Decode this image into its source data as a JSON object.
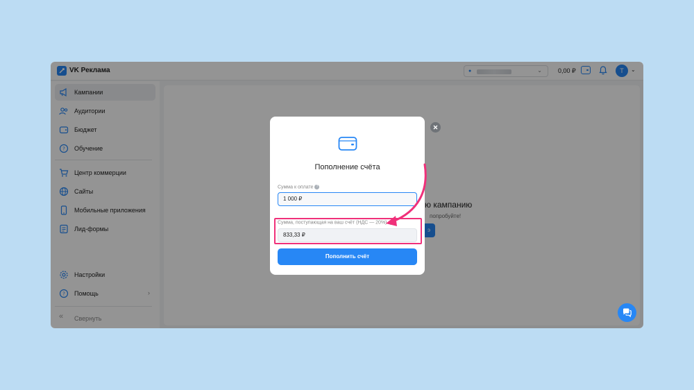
{
  "header": {
    "logo_text": "VK Реклама",
    "balance": "0,00 ₽",
    "avatar_letter": "T"
  },
  "sidebar": {
    "items": [
      {
        "label": "Кампании",
        "icon": "megaphone-icon"
      },
      {
        "label": "Аудитории",
        "icon": "people-icon"
      },
      {
        "label": "Бюджет",
        "icon": "wallet-icon"
      },
      {
        "label": "Обучение",
        "icon": "question-icon"
      },
      {
        "label": "Центр коммерции",
        "icon": "cart-icon"
      },
      {
        "label": "Сайты",
        "icon": "globe-icon"
      },
      {
        "label": "Мобильные приложения",
        "icon": "phone-icon"
      },
      {
        "label": "Лид-формы",
        "icon": "form-icon"
      },
      {
        "label": "Настройки",
        "icon": "gear-icon"
      },
      {
        "label": "Помощь",
        "icon": "question-icon"
      },
      {
        "label": "Свернуть",
        "icon": "double-chevron-left-icon"
      }
    ]
  },
  "main": {
    "empty_title": "ую кампанию",
    "empty_subtitle": "попробуйте!",
    "empty_button": "э"
  },
  "modal": {
    "title": "Пополнение счёта",
    "amount_label": "Сумма к оплате",
    "amount_value": "1 000 ₽",
    "credited_label": "Сумма, поступающая на ваш счёт (НДС — 20%)",
    "credited_value": "833,33 ₽",
    "submit_label": "Пополнить счёт"
  },
  "colors": {
    "accent": "#2787f5",
    "highlight": "#f0307a",
    "page_background": "#bcdcf3"
  }
}
